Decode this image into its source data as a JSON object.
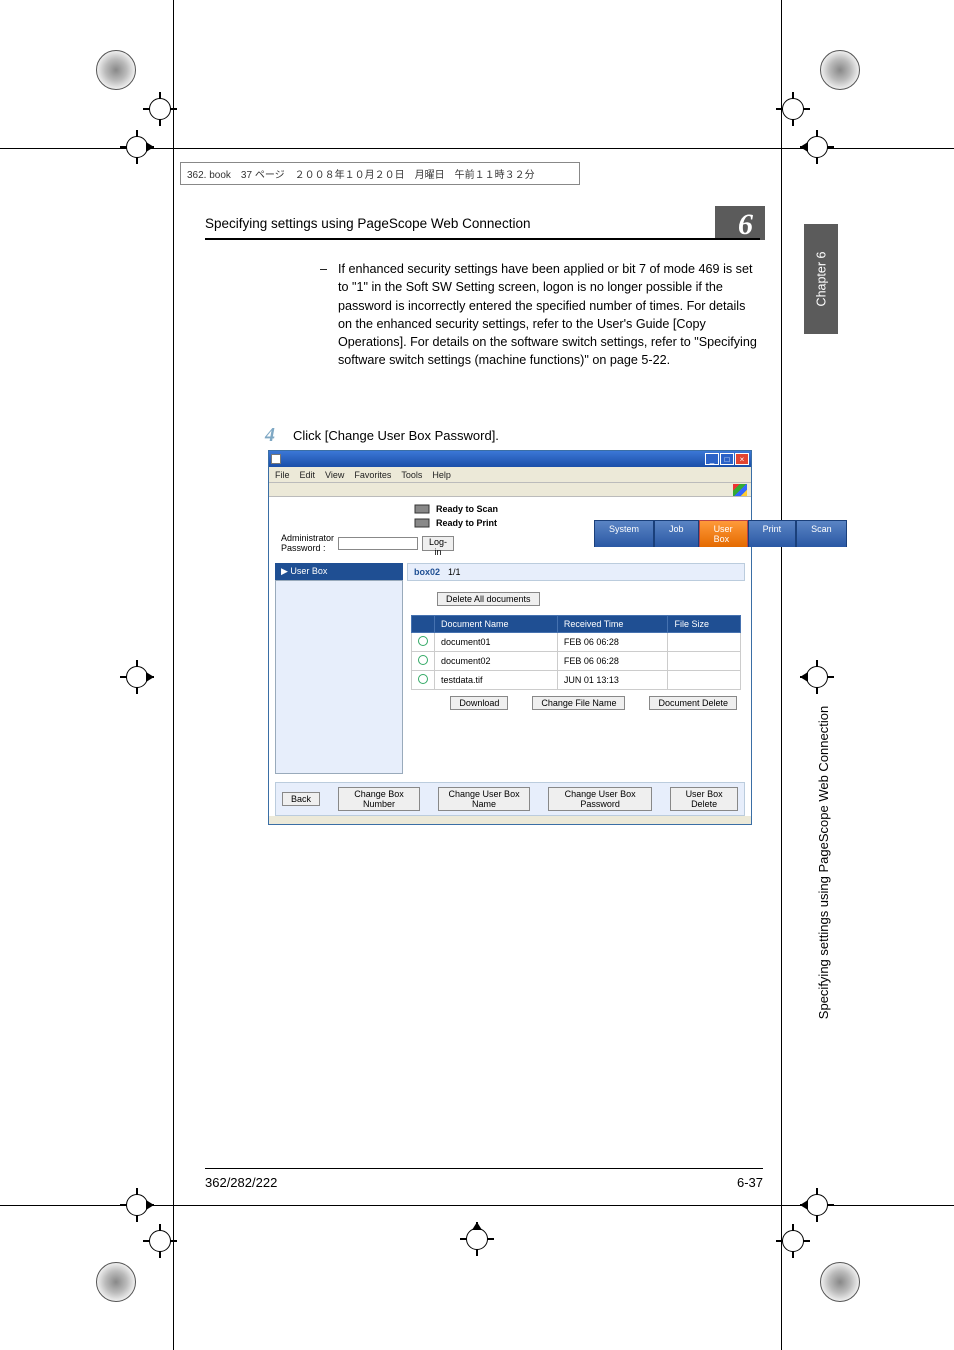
{
  "bookinfo": "362. book　37 ページ　２００８年１０月２０日　月曜日　午前１１時３２分",
  "header": {
    "title": "Specifying settings using PageScope Web Connection",
    "chapter_num": "6"
  },
  "side_labels": {
    "chapter": "Chapter 6",
    "title": "Specifying settings using PageScope Web Connection"
  },
  "body": {
    "bullet": "–",
    "para": "If enhanced security settings have been applied or bit 7 of mode 469 is set to \"1\" in the Soft SW Setting screen, logon is no longer possible if the password is incorrectly entered the specified number of times. For details on the enhanced security settings, refer to the User's Guide [Copy Operations]. For details on the software switch settings, refer to \"Specifying software switch settings (machine functions)\" on page 5-22."
  },
  "step": {
    "num": "4",
    "text": "Click [Change User Box Password]."
  },
  "browser": {
    "menus": [
      "File",
      "Edit",
      "View",
      "Favorites",
      "Tools",
      "Help"
    ],
    "status": {
      "scan": "Ready to Scan",
      "print": "Ready to Print"
    },
    "admin": {
      "label": "Administrator Password :",
      "login": "Log-in"
    },
    "tabs": [
      "System",
      "Job",
      "User Box",
      "Print",
      "Scan"
    ],
    "tab_selected_index": 2,
    "side_head": "▶ User Box",
    "box_label_name": "box02",
    "box_label_page": "1/1",
    "delete_all": "Delete All documents",
    "columns": {
      "sel": "",
      "name": "Document Name",
      "time": "Received Time",
      "size": "File Size"
    },
    "rows": [
      {
        "name": "document01",
        "time": "FEB 06 06:28",
        "size": ""
      },
      {
        "name": "document02",
        "time": "FEB 06 06:28",
        "size": ""
      },
      {
        "name": "testdata.tif",
        "time": "JUN 01 13:13",
        "size": ""
      }
    ],
    "row_actions": {
      "download": "Download",
      "change_file": "Change File Name",
      "doc_delete": "Document Delete"
    },
    "bottom_actions": {
      "back": "Back",
      "change_box_num": "Change Box Number",
      "change_box_name": "Change User Box Name",
      "change_box_pw": "Change User Box Password",
      "box_delete": "User Box Delete"
    }
  },
  "footer": {
    "left": "362/282/222",
    "right": "6-37"
  }
}
